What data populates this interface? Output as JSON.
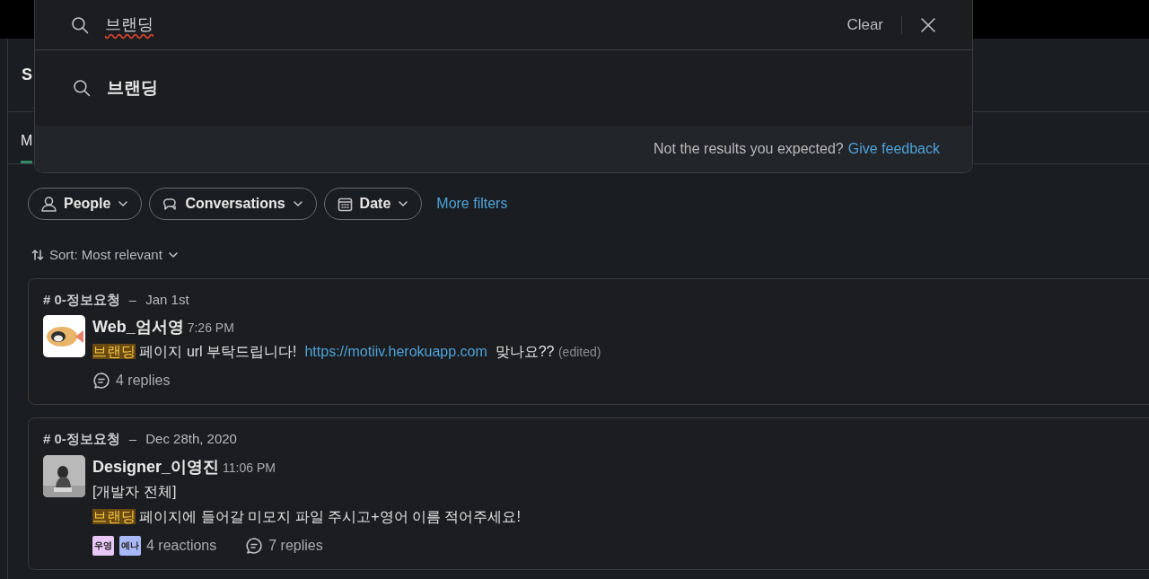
{
  "background": {
    "header_title": "S",
    "tabs": [
      {
        "label": "M",
        "selected": true
      }
    ]
  },
  "search_overlay": {
    "query": "브랜딩",
    "clear": "Clear",
    "suggestion": "브랜딩",
    "footer_text": "Not the results you expected?",
    "footer_link": "Give feedback"
  },
  "filters": [
    {
      "label": "People",
      "kind": "people"
    },
    {
      "label": "Conversations",
      "kind": "conversations"
    },
    {
      "label": "Date",
      "kind": "date"
    }
  ],
  "more_filters": "More filters",
  "sort": "Sort: Most relevant",
  "results": [
    {
      "channel": "# 0-정보요청",
      "separator": "–",
      "date": "Jan 1st",
      "author": "Web_엄서영",
      "time": "7:26 PM",
      "lines": [
        [
          {
            "kind": "highlight",
            "text": "브랜딩"
          },
          {
            "kind": "text",
            "text": " 페이지 url 부탁드립니다!  "
          },
          {
            "kind": "link",
            "text": "https://motiiv.herokuapp.com"
          },
          {
            "kind": "text",
            "text": "  맞나요?? "
          },
          {
            "kind": "muted",
            "text": "(edited)"
          }
        ]
      ],
      "replies": "4 replies"
    },
    {
      "channel": "# 0-정보요청",
      "separator": "–",
      "date": "Dec 28th, 2020",
      "author": "Designer_이영진",
      "time": "11:06 PM",
      "lines": [
        [
          {
            "kind": "text",
            "text": "[개발자 전체]"
          }
        ],
        [
          {
            "kind": "highlight",
            "text": "브랜딩"
          },
          {
            "kind": "text",
            "text": " 페이지에 들어갈 미모지 파일 주시고+영어 이름 적어주세요!"
          }
        ]
      ],
      "reactions": [
        {
          "text": "우영",
          "color": "#e8c6f5"
        },
        {
          "text": "예나",
          "color": "#a9b8f7"
        }
      ],
      "reactions_label": "4 reactions",
      "replies": "7 replies"
    }
  ]
}
